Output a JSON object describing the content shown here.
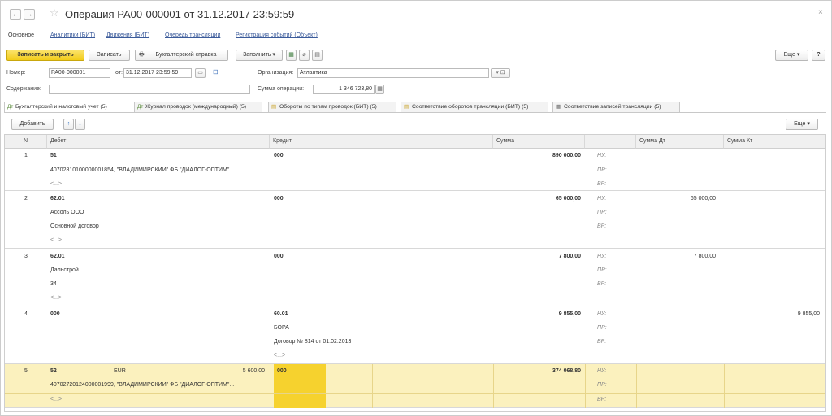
{
  "window": {
    "title": "Операция РА00-000001 от 31.12.2017 23:59:59",
    "close_label": "×",
    "back_label": "←",
    "forward_label": "→",
    "star_label": "☆"
  },
  "subnav": {
    "main": "Основное",
    "links": [
      "Аналитики (БИТ)",
      "Движения (БИТ)",
      "Очередь трансляции",
      "Регистрация событий (Объект)"
    ]
  },
  "toolbar": {
    "save_close": "Записать и закрыть",
    "save": "Записать",
    "report": "Бухгалтерский справка",
    "fill": "Заполнить",
    "more": "Еще",
    "help": "?"
  },
  "form": {
    "number_label": "Номер:",
    "number_value": "РА00-000001",
    "date_label": "от:",
    "date_value": "31.12.2017 23:59:59",
    "org_label": "Организация:",
    "org_value": "Атлантика",
    "content_label": "Содержание:",
    "content_value": "",
    "sum_label": "Сумма операции:",
    "sum_value": "1 346 723,80"
  },
  "tabs": [
    {
      "label": "Бухгалтерский и налоговый учет (5)",
      "icon": "Дт"
    },
    {
      "label": "Журнал проводок (международный) (5)",
      "icon": "Дт"
    },
    {
      "label": "Обороты по типам проводок (БИТ) (5)",
      "icon": "▤"
    },
    {
      "label": "Соответствие оборотов трансляции (БИТ) (5)",
      "icon": "▤"
    },
    {
      "label": "Соответствие записей трансляции (5)",
      "icon": "▦"
    }
  ],
  "table_toolbar": {
    "add": "Добавить",
    "up": "↑",
    "down": "↓",
    "more": "Еще"
  },
  "table": {
    "headers": [
      "N",
      "Дебет",
      "Кредит",
      "Сумма",
      "",
      "Сумма Дт",
      "Сумма Кт"
    ],
    "tax_labels": [
      "НУ:",
      "ПР:",
      "ВР:"
    ],
    "ellipsis": "<...>",
    "rows": [
      {
        "n": "1",
        "debit": "51",
        "debit_sub1": "40702810100000001854, \"ВЛАДИМИРСКИЙ\" ФБ \"ДИАЛОГ-ОПТИМ\"...",
        "debit_sub2": "<...>",
        "credit": "000",
        "credit_sub1": "",
        "credit_sub2": "",
        "sum": "890 000,00",
        "sum_dt": "",
        "sum_kt": ""
      },
      {
        "n": "2",
        "debit": "62.01",
        "debit_sub1": "Ассоль ООО",
        "debit_sub2": "Основной договор",
        "debit_sub3": "<...>",
        "credit": "000",
        "sum": "65 000,00",
        "sum_dt": "65 000,00",
        "sum_kt": ""
      },
      {
        "n": "3",
        "debit": "62.01",
        "debit_sub1": "Дальстрой",
        "debit_sub2": "34",
        "debit_sub3": "<...>",
        "credit": "000",
        "sum": "7 800,00",
        "sum_dt": "7 800,00",
        "sum_kt": ""
      },
      {
        "n": "4",
        "debit": "000",
        "credit": "60.01",
        "credit_sub1": "БОРА",
        "credit_sub2": "Договор № 814 от 01.02.2013",
        "credit_sub3": "<...>",
        "sum": "9 855,00",
        "sum_dt": "",
        "sum_kt": "9 855,00"
      },
      {
        "n": "5",
        "debit": "52",
        "currency": "EUR",
        "currency_sum": "5 600,00",
        "debit_sub1": "40702720124000001999, \"ВЛАДИМИРСКИЙ\" ФБ \"ДИАЛОГ-ОПТИМ\"...",
        "debit_sub2": "<...>",
        "credit": "000",
        "sum": "374 068,80",
        "sum_dt": "",
        "sum_kt": ""
      }
    ]
  },
  "colors": {
    "primary_button": "#f2cc1a",
    "selected_row": "#fbf1be",
    "selected_cell": "#f6d22e",
    "link": "#3a5a9a"
  }
}
